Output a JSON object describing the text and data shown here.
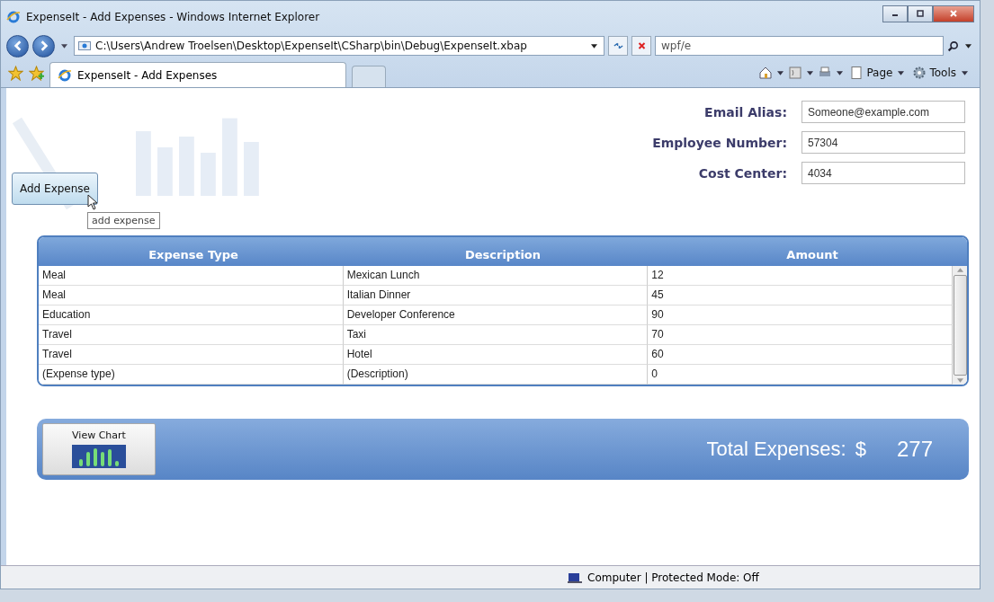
{
  "window": {
    "title": "ExpenseIt - Add Expenses - Windows Internet Explorer"
  },
  "address_bar": {
    "value": "C:\\Users\\Andrew Troelsen\\Desktop\\ExpenseIt\\CSharp\\bin\\Debug\\ExpenseIt.xbap"
  },
  "search": {
    "value": "wpf/e"
  },
  "tab": {
    "label": "ExpenseIt - Add Expenses",
    "selected": true
  },
  "command_bar": {
    "page": "Page",
    "tools": "Tools"
  },
  "add_button": {
    "label": "Add Expense",
    "tooltip": "add expense"
  },
  "form": [
    {
      "label": "Email Alias:",
      "value": "Someone@example.com"
    },
    {
      "label": "Employee Number:",
      "value": "57304"
    },
    {
      "label": "Cost Center:",
      "value": "4034"
    }
  ],
  "table": {
    "columns": [
      "Expense Type",
      "Description",
      "Amount"
    ],
    "rows": [
      [
        "Meal",
        "Mexican Lunch",
        "12"
      ],
      [
        "Meal",
        "Italian Dinner",
        "45"
      ],
      [
        "Education",
        "Developer Conference",
        "90"
      ],
      [
        "Travel",
        "Taxi",
        "70"
      ],
      [
        "Travel",
        "Hotel",
        "60"
      ],
      [
        "(Expense type)",
        "(Description)",
        "0"
      ]
    ]
  },
  "view_chart": {
    "label": "View Chart"
  },
  "total": {
    "label": "Total Expenses:",
    "currency": "$",
    "value": "277"
  },
  "status_bar": {
    "zone": "Computer | Protected Mode: Off"
  }
}
